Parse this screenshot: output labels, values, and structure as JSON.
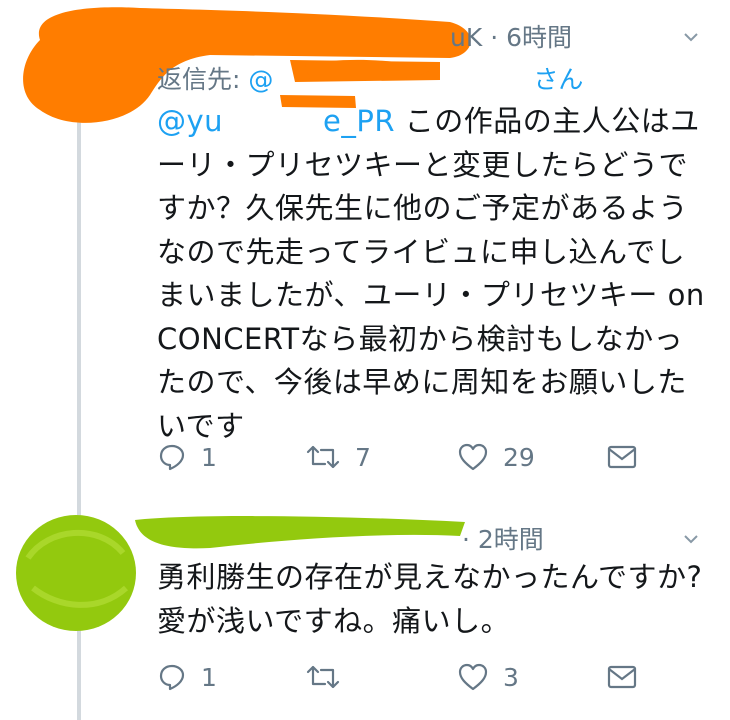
{
  "tweets": [
    {
      "handle_suffix": "uK",
      "time": "· 6時間",
      "reply_label": "返信先:",
      "reply_mention_start": "@",
      "reply_mention_end": "さん",
      "text_mention": "@yu",
      "text_mention_tail": "e_PR",
      "text_body": " この作品の主人公はユーリ・プリセツキーと変更したらどうですか？久保先生に他のご予定があるようなので先走ってライビュに申し込んでしまいましたが、ユーリ・プリセツキー on CONCERTなら最初から検討もしなかったので、今後は早めに周知をお願いしたいです",
      "actions": {
        "reply_count": "1",
        "retweet_count": "7",
        "like_count": "29"
      }
    },
    {
      "time": "· 2時間",
      "text_body": "勇利勝生の存在が見えなかったんですか?愛が浅いですね。痛いし。",
      "actions": {
        "reply_count": "1",
        "retweet_count": "",
        "like_count": "3"
      }
    }
  ],
  "colors": {
    "accent": "#1da1f2",
    "muted": "#657786",
    "text": "#14171a",
    "thread_line": "#d3d9de",
    "redact_orange": "#ff7d00",
    "redact_green": "#93c90e"
  },
  "icons": [
    "chevron-down-icon",
    "reply-icon",
    "retweet-icon",
    "like-icon",
    "message-icon"
  ]
}
